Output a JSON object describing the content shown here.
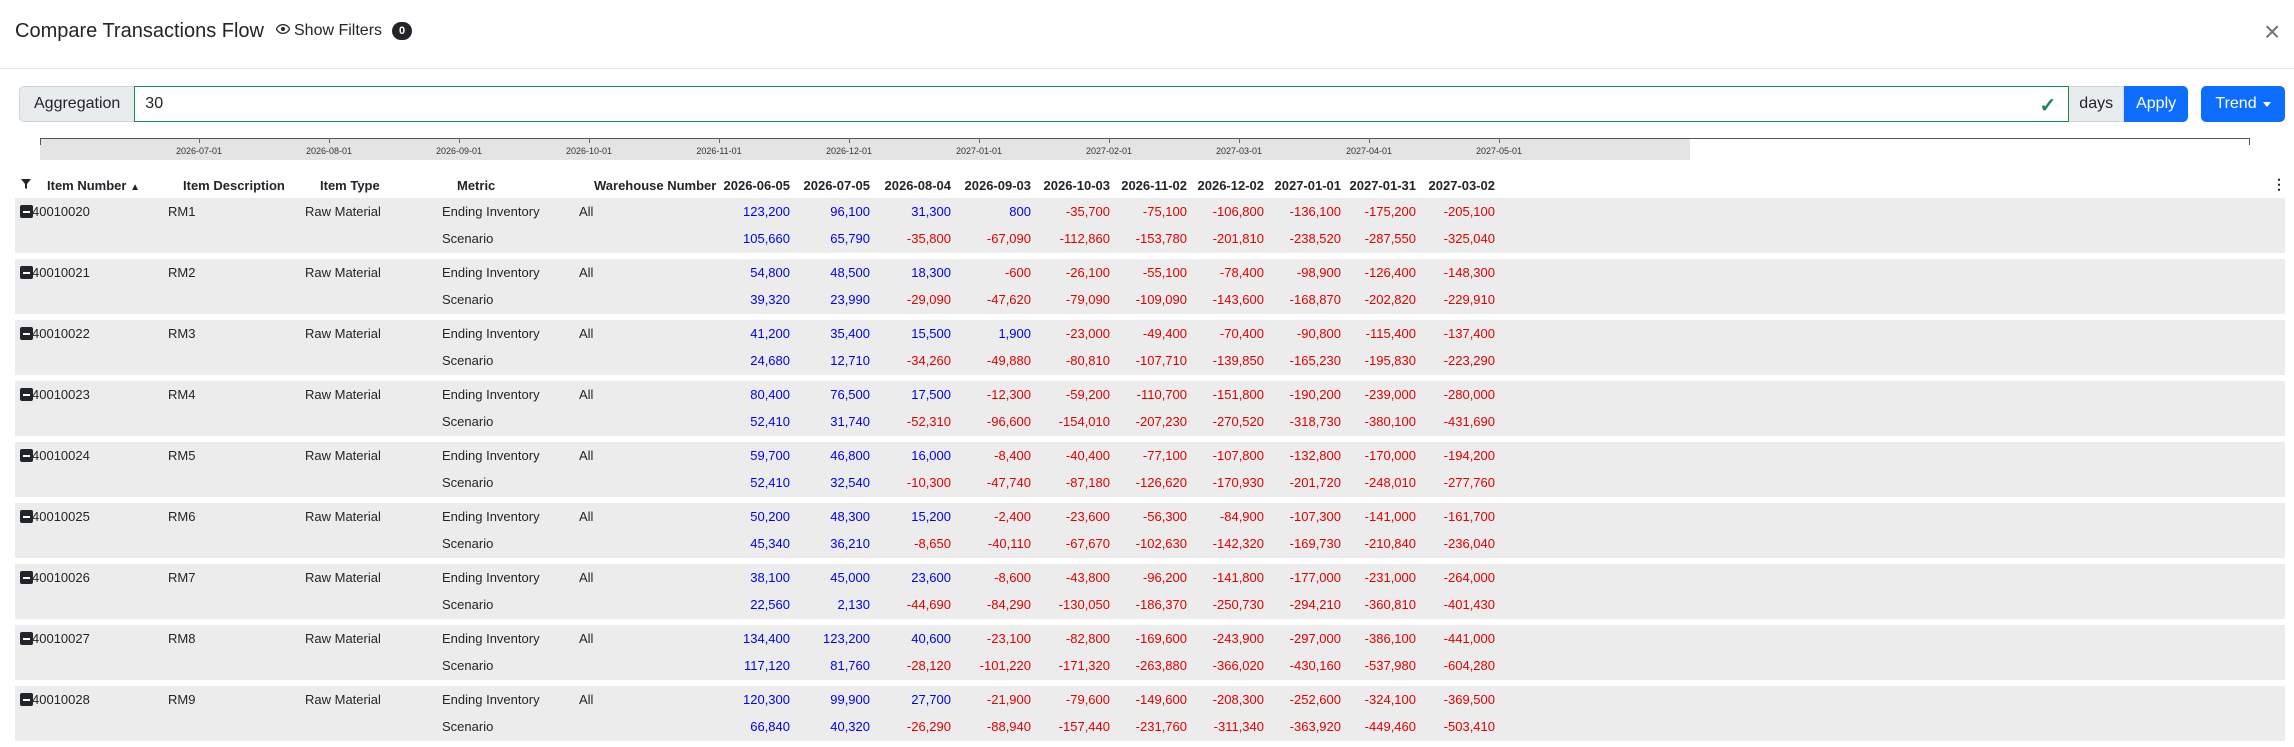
{
  "header": {
    "title": "Compare Transactions Flow",
    "show_filters_label": "Show Filters",
    "filters_count": "0",
    "close_glyph": "×"
  },
  "toolbar": {
    "aggregation_label": "Aggregation",
    "aggregation_value": "30",
    "days_label": "days",
    "apply_label": "Apply",
    "trend_label": "Trend"
  },
  "timeline": {
    "labels": [
      "2026-07-01",
      "2026-08-01",
      "2026-09-01",
      "2026-10-01",
      "2026-11-01",
      "2026-12-01",
      "2027-01-01",
      "2027-02-01",
      "2027-03-01",
      "2027-04-01",
      "2027-05-01"
    ]
  },
  "table": {
    "columns": {
      "item_number": "Item Number",
      "item_description": "Item Description",
      "item_type": "Item Type",
      "metric": "Metric",
      "warehouse_number": "Warehouse Number"
    },
    "dates": [
      "2026-06-05",
      "2026-07-05",
      "2026-08-04",
      "2026-09-03",
      "2026-10-03",
      "2026-11-02",
      "2026-12-02",
      "2027-01-01",
      "2027-01-31",
      "2027-03-02"
    ],
    "rows": [
      {
        "item": "40010020",
        "desc": "RM1",
        "type": "Raw Material",
        "warehouse": "All",
        "metric1": "Ending Inventory",
        "metric2": "Scenario",
        "v1": [
          "123,200",
          "96,100",
          "31,300",
          "800",
          "-35,700",
          "-75,100",
          "-106,800",
          "-136,100",
          "-175,200",
          "-205,100"
        ],
        "v2": [
          "105,660",
          "65,790",
          "-35,800",
          "-67,090",
          "-112,860",
          "-153,780",
          "-201,810",
          "-238,520",
          "-287,550",
          "-325,040"
        ]
      },
      {
        "item": "40010021",
        "desc": "RM2",
        "type": "Raw Material",
        "warehouse": "All",
        "metric1": "Ending Inventory",
        "metric2": "Scenario",
        "v1": [
          "54,800",
          "48,500",
          "18,300",
          "-600",
          "-26,100",
          "-55,100",
          "-78,400",
          "-98,900",
          "-126,400",
          "-148,300"
        ],
        "v2": [
          "39,320",
          "23,990",
          "-29,090",
          "-47,620",
          "-79,090",
          "-109,090",
          "-143,600",
          "-168,870",
          "-202,820",
          "-229,910"
        ]
      },
      {
        "item": "40010022",
        "desc": "RM3",
        "type": "Raw Material",
        "warehouse": "All",
        "metric1": "Ending Inventory",
        "metric2": "Scenario",
        "v1": [
          "41,200",
          "35,400",
          "15,500",
          "1,900",
          "-23,000",
          "-49,400",
          "-70,400",
          "-90,800",
          "-115,400",
          "-137,400"
        ],
        "v2": [
          "24,680",
          "12,710",
          "-34,260",
          "-49,880",
          "-80,810",
          "-107,710",
          "-139,850",
          "-165,230",
          "-195,830",
          "-223,290"
        ]
      },
      {
        "item": "40010023",
        "desc": "RM4",
        "type": "Raw Material",
        "warehouse": "All",
        "metric1": "Ending Inventory",
        "metric2": "Scenario",
        "v1": [
          "80,400",
          "76,500",
          "17,500",
          "-12,300",
          "-59,200",
          "-110,700",
          "-151,800",
          "-190,200",
          "-239,000",
          "-280,000"
        ],
        "v2": [
          "52,410",
          "31,740",
          "-52,310",
          "-96,600",
          "-154,010",
          "-207,230",
          "-270,520",
          "-318,730",
          "-380,100",
          "-431,690"
        ]
      },
      {
        "item": "40010024",
        "desc": "RM5",
        "type": "Raw Material",
        "warehouse": "All",
        "metric1": "Ending Inventory",
        "metric2": "Scenario",
        "v1": [
          "59,700",
          "46,800",
          "16,000",
          "-8,400",
          "-40,400",
          "-77,100",
          "-107,800",
          "-132,800",
          "-170,000",
          "-194,200"
        ],
        "v2": [
          "52,410",
          "32,540",
          "-10,300",
          "-47,740",
          "-87,180",
          "-126,620",
          "-170,930",
          "-201,720",
          "-248,010",
          "-277,760"
        ]
      },
      {
        "item": "40010025",
        "desc": "RM6",
        "type": "Raw Material",
        "warehouse": "All",
        "metric1": "Ending Inventory",
        "metric2": "Scenario",
        "v1": [
          "50,200",
          "48,300",
          "15,200",
          "-2,400",
          "-23,600",
          "-56,300",
          "-84,900",
          "-107,300",
          "-141,000",
          "-161,700"
        ],
        "v2": [
          "45,340",
          "36,210",
          "-8,650",
          "-40,110",
          "-67,670",
          "-102,630",
          "-142,320",
          "-169,730",
          "-210,840",
          "-236,040"
        ]
      },
      {
        "item": "40010026",
        "desc": "RM7",
        "type": "Raw Material",
        "warehouse": "All",
        "metric1": "Ending Inventory",
        "metric2": "Scenario",
        "v1": [
          "38,100",
          "45,000",
          "23,600",
          "-8,600",
          "-43,800",
          "-96,200",
          "-141,800",
          "-177,000",
          "-231,000",
          "-264,000"
        ],
        "v2": [
          "22,560",
          "2,130",
          "-44,690",
          "-84,290",
          "-130,050",
          "-186,370",
          "-250,730",
          "-294,210",
          "-360,810",
          "-401,430"
        ]
      },
      {
        "item": "40010027",
        "desc": "RM8",
        "type": "Raw Material",
        "warehouse": "All",
        "metric1": "Ending Inventory",
        "metric2": "Scenario",
        "v1": [
          "134,400",
          "123,200",
          "40,600",
          "-23,100",
          "-82,800",
          "-169,600",
          "-243,900",
          "-297,000",
          "-386,100",
          "-441,000"
        ],
        "v2": [
          "117,120",
          "81,760",
          "-28,120",
          "-101,220",
          "-171,320",
          "-263,880",
          "-366,020",
          "-430,160",
          "-537,980",
          "-604,280"
        ]
      },
      {
        "item": "40010028",
        "desc": "RM9",
        "type": "Raw Material",
        "warehouse": "All",
        "metric1": "Ending Inventory",
        "metric2": "Scenario",
        "v1": [
          "120,300",
          "99,900",
          "27,700",
          "-21,900",
          "-79,600",
          "-149,600",
          "-208,300",
          "-252,600",
          "-324,100",
          "-369,500"
        ],
        "v2": [
          "66,840",
          "40,320",
          "-26,290",
          "-88,940",
          "-157,440",
          "-231,760",
          "-311,340",
          "-363,920",
          "-449,460",
          "-503,410"
        ]
      }
    ]
  },
  "colors": {
    "positive": "#0000ee",
    "negative": "#e00000",
    "accent": "#0d6efd",
    "valid": "#198754"
  },
  "icons": [
    "eye-icon",
    "close-icon",
    "check-icon",
    "caret-down-icon",
    "filter-icon",
    "sort-asc-icon",
    "kebab-menu-icon",
    "collapse-row-icon"
  ]
}
